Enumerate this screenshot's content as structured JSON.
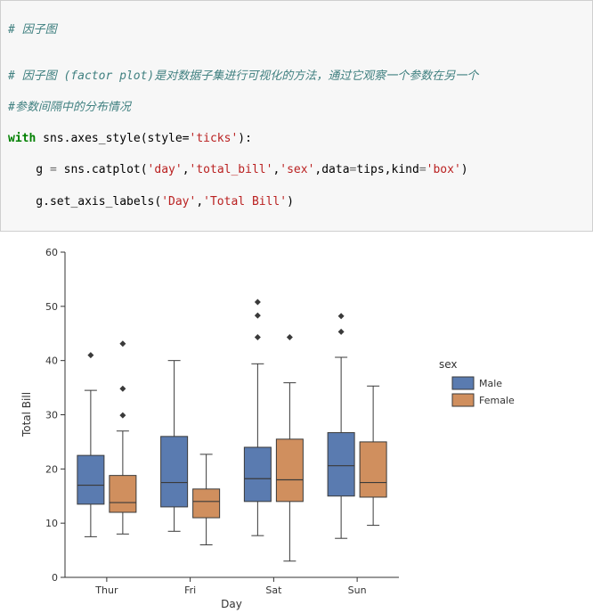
{
  "code": {
    "line1": "# 因子图",
    "line2": "",
    "line3_a": "# 因子图 (factor plot)是对数据子集进行可视化的方法，通过它观察一个参数在另一个",
    "line3_b": "#参数间隔中的分布情况",
    "line4_with": "with",
    "line4_rest_a": " sns.axes_style(style=",
    "line4_str1": "'ticks'",
    "line4_rest_b": "):",
    "line5_a": "    g ",
    "line5_eq": "=",
    "line5_b": " sns.catplot(",
    "line5_s1": "'day'",
    "line5_c1": ",",
    "line5_s2": "'total_bill'",
    "line5_c2": ",",
    "line5_s3": "'sex'",
    "line5_c3": ",data",
    "line5_eq2": "=",
    "line5_d": "tips,kind",
    "line5_eq3": "=",
    "line5_s4": "'box'",
    "line5_e": ")",
    "line6_a": "    g.set_axis_labels(",
    "line6_s1": "'Day'",
    "line6_c1": ",",
    "line6_s2": "'Total Bill'",
    "line6_b": ")"
  },
  "chart_data": {
    "type": "boxplot-grouped",
    "xlabel": "Day",
    "ylabel": "Total Bill",
    "ylim": [
      0,
      60
    ],
    "yticks": [
      0,
      10,
      20,
      30,
      40,
      50,
      60
    ],
    "categories": [
      "Thur",
      "Fri",
      "Sat",
      "Sun"
    ],
    "legend": {
      "title": "sex",
      "entries": [
        "Male",
        "Female"
      ]
    },
    "colors": {
      "Male": "#5a7bb0",
      "Female": "#d08f5e"
    },
    "series": {
      "Male": {
        "Thur": {
          "whisker_low": 7.5,
          "q1": 13.5,
          "median": 17.0,
          "q3": 22.5,
          "whisker_high": 34.5,
          "outliers": [
            41.0
          ]
        },
        "Fri": {
          "whisker_low": 8.5,
          "q1": 13.0,
          "median": 17.5,
          "q3": 26.0,
          "whisker_high": 40.0,
          "outliers": []
        },
        "Sat": {
          "whisker_low": 7.7,
          "q1": 14.0,
          "median": 18.2,
          "q3": 24.0,
          "whisker_high": 39.4,
          "outliers": [
            48.3,
            50.8,
            44.3
          ]
        },
        "Sun": {
          "whisker_low": 7.2,
          "q1": 15.0,
          "median": 20.6,
          "q3": 26.7,
          "whisker_high": 40.6,
          "outliers": [
            48.2,
            45.3
          ]
        }
      },
      "Female": {
        "Thur": {
          "whisker_low": 8.0,
          "q1": 12.0,
          "median": 13.8,
          "q3": 18.8,
          "whisker_high": 27.0,
          "outliers": [
            43.1,
            34.8,
            29.9
          ]
        },
        "Fri": {
          "whisker_low": 6.0,
          "q1": 11.0,
          "median": 14.0,
          "q3": 16.3,
          "whisker_high": 22.7,
          "outliers": []
        },
        "Sat": {
          "whisker_low": 3.0,
          "q1": 14.0,
          "median": 18.0,
          "q3": 25.5,
          "whisker_high": 35.9,
          "outliers": [
            44.3
          ]
        },
        "Sun": {
          "whisker_low": 9.6,
          "q1": 14.8,
          "median": 17.5,
          "q3": 25.0,
          "whisker_high": 35.3,
          "outliers": []
        }
      }
    }
  }
}
